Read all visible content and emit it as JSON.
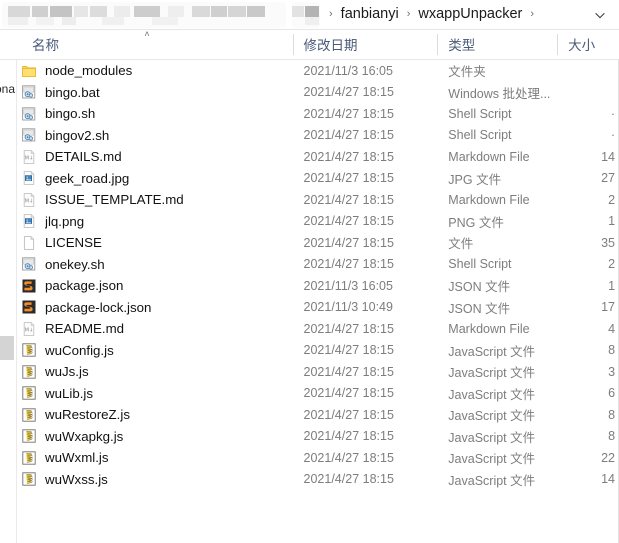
{
  "window": {
    "title": "wxappUnpacker"
  },
  "address_bar": {
    "redacted_label": "redacted-path",
    "breadcrumbs": [
      {
        "label": "fanbianyi"
      },
      {
        "label": "wxappUnpacker"
      }
    ],
    "separator": "›",
    "dropdown_icon": "chevron-down-icon"
  },
  "columns": {
    "name": "名称",
    "date_modified": "修改日期",
    "type": "类型",
    "size": "大小",
    "sort_caret": "˄",
    "sort_column": "name",
    "sort_direction": "ascending"
  },
  "nav_pane": {
    "clipped_label": "ona"
  },
  "files": [
    {
      "name": "node_modules",
      "icon": "folder-icon",
      "date": "2021/11/3 16:05",
      "type": "文件夹",
      "size": ""
    },
    {
      "name": "bingo.bat",
      "icon": "script-icon",
      "date": "2021/4/27 18:15",
      "type": "Windows 批处理...",
      "size": ""
    },
    {
      "name": "bingo.sh",
      "icon": "script-icon",
      "date": "2021/4/27 18:15",
      "type": "Shell Script",
      "size": "·"
    },
    {
      "name": "bingov2.sh",
      "icon": "script-icon",
      "date": "2021/4/27 18:15",
      "type": "Shell Script",
      "size": "·"
    },
    {
      "name": "DETAILS.md",
      "icon": "markdown-icon",
      "date": "2021/4/27 18:15",
      "type": "Markdown File",
      "size": "14"
    },
    {
      "name": "geek_road.jpg",
      "icon": "image-icon",
      "date": "2021/4/27 18:15",
      "type": "JPG 文件",
      "size": "27"
    },
    {
      "name": "ISSUE_TEMPLATE.md",
      "icon": "markdown-icon",
      "date": "2021/4/27 18:15",
      "type": "Markdown File",
      "size": "2"
    },
    {
      "name": "jlq.png",
      "icon": "image-icon",
      "date": "2021/4/27 18:15",
      "type": "PNG 文件",
      "size": "1"
    },
    {
      "name": "LICENSE",
      "icon": "blank-file-icon",
      "date": "2021/4/27 18:15",
      "type": "文件",
      "size": "35"
    },
    {
      "name": "onekey.sh",
      "icon": "script-icon",
      "date": "2021/4/27 18:15",
      "type": "Shell Script",
      "size": "2"
    },
    {
      "name": "package.json",
      "icon": "json-icon",
      "date": "2021/11/3 16:05",
      "type": "JSON 文件",
      "size": "1"
    },
    {
      "name": "package-lock.json",
      "icon": "json-icon",
      "date": "2021/11/3 10:49",
      "type": "JSON 文件",
      "size": "17"
    },
    {
      "name": "README.md",
      "icon": "markdown-icon",
      "date": "2021/4/27 18:15",
      "type": "Markdown File",
      "size": "4"
    },
    {
      "name": "wuConfig.js",
      "icon": "javascript-icon",
      "date": "2021/4/27 18:15",
      "type": "JavaScript 文件",
      "size": "8"
    },
    {
      "name": "wuJs.js",
      "icon": "javascript-icon",
      "date": "2021/4/27 18:15",
      "type": "JavaScript 文件",
      "size": "3"
    },
    {
      "name": "wuLib.js",
      "icon": "javascript-icon",
      "date": "2021/4/27 18:15",
      "type": "JavaScript 文件",
      "size": "6"
    },
    {
      "name": "wuRestoreZ.js",
      "icon": "javascript-icon",
      "date": "2021/4/27 18:15",
      "type": "JavaScript 文件",
      "size": "8"
    },
    {
      "name": "wuWxapkg.js",
      "icon": "javascript-icon",
      "date": "2021/4/27 18:15",
      "type": "JavaScript 文件",
      "size": "8"
    },
    {
      "name": "wuWxml.js",
      "icon": "javascript-icon",
      "date": "2021/4/27 18:15",
      "type": "JavaScript 文件",
      "size": "22"
    },
    {
      "name": "wuWxss.js",
      "icon": "javascript-icon",
      "date": "2021/4/27 18:15",
      "type": "JavaScript 文件",
      "size": "14"
    }
  ],
  "colors": {
    "folder": "#ffd34e",
    "header_text": "#4a5a78",
    "row_text": "#121212",
    "meta_text": "#7d7d7d",
    "json_icon_bg": "#282828",
    "json_icon_fg": "#f58c27",
    "js_icon_fg": "#e8c84a"
  }
}
